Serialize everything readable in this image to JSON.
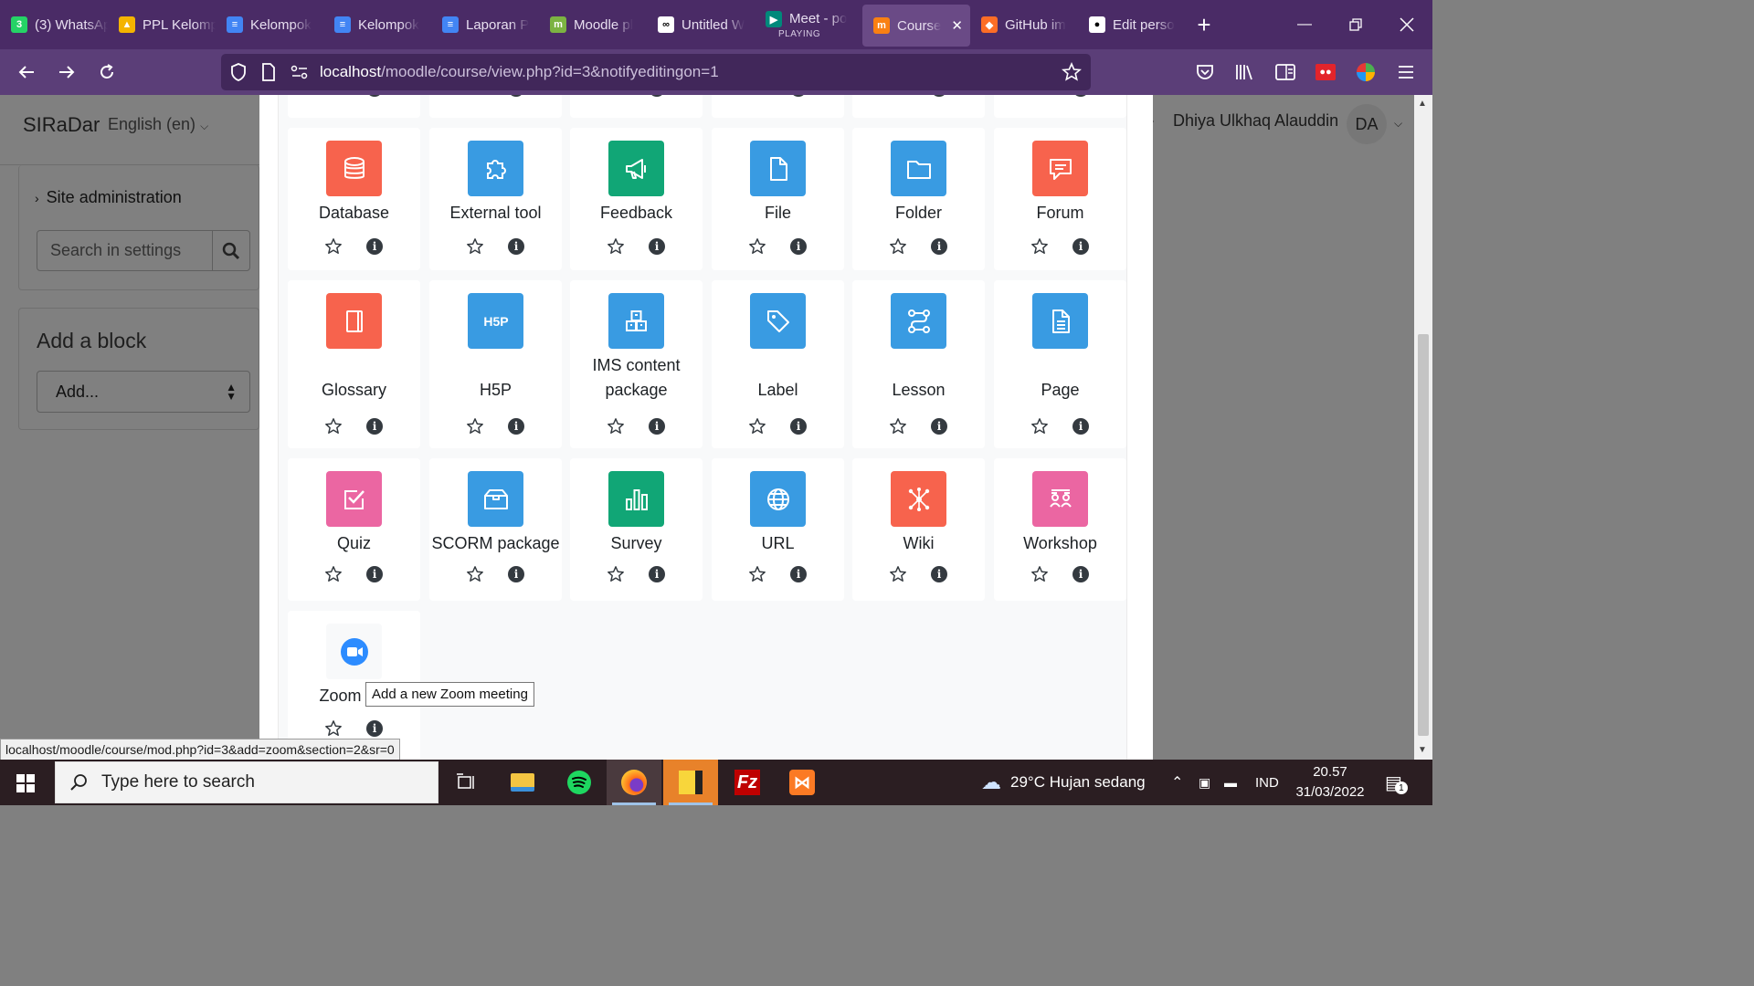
{
  "browser": {
    "tabs": [
      {
        "label": "(3) WhatsApp",
        "icon": "whatsapp-icon",
        "color": "#25d366",
        "glyph": "3"
      },
      {
        "label": "PPL Kelompok",
        "icon": "google-drive-icon",
        "color": "#f4b400",
        "glyph": "▲"
      },
      {
        "label": "Kelompok",
        "icon": "google-docs-icon",
        "color": "#4285f4",
        "glyph": "≡"
      },
      {
        "label": "Kelompok",
        "icon": "google-docs-icon",
        "color": "#4285f4",
        "glyph": "≡"
      },
      {
        "label": "Laporan P",
        "icon": "google-docs-icon",
        "color": "#4285f4",
        "glyph": "≡"
      },
      {
        "label": "Moodle pl",
        "icon": "moodle-icon",
        "color": "#7cb342",
        "glyph": "m"
      },
      {
        "label": "Untitled W",
        "icon": "drawio-icon",
        "color": "#ffffff",
        "glyph": "∞"
      },
      {
        "label": "Meet - po",
        "sub": "PLAYING",
        "icon": "google-meet-icon",
        "color": "#00897b",
        "glyph": "▶"
      },
      {
        "label": "Course",
        "icon": "moodle-icon",
        "color": "#f98012",
        "glyph": "m",
        "active": true
      },
      {
        "label": "GitHub im",
        "icon": "gitlab-icon",
        "color": "#fc6d26",
        "glyph": "◆"
      },
      {
        "label": "Edit perso",
        "icon": "github-icon",
        "color": "#ffffff",
        "glyph": "●"
      }
    ],
    "url_host": "localhost",
    "url_path": "/moodle/course/view.php?id=3&notifyeditingon=1",
    "status_url": "localhost/moodle/course/mod.php?id=3&add=zoom&section=2&sr=0"
  },
  "page": {
    "brand": "SIRaDar",
    "language": "English (en)",
    "site_admin": "Site administration",
    "search_placeholder": "Search in settings",
    "add_block_title": "Add a block",
    "add_select": "Add...",
    "user_name": "Dhiya Ulkhaq Alauddin",
    "user_initials": "DA"
  },
  "modal": {
    "activities": [
      {
        "name": "Database",
        "color": "#f7634d",
        "icon": "database-icon"
      },
      {
        "name": "External tool",
        "color": "#399be2",
        "icon": "puzzle-icon"
      },
      {
        "name": "Feedback",
        "color": "#11a676",
        "icon": "megaphone-icon"
      },
      {
        "name": "File",
        "color": "#399be2",
        "icon": "file-icon"
      },
      {
        "name": "Folder",
        "color": "#399be2",
        "icon": "folder-icon"
      },
      {
        "name": "Forum",
        "color": "#f7634d",
        "icon": "chat-icon"
      },
      {
        "name": "Glossary",
        "color": "#f7634d",
        "icon": "book-icon"
      },
      {
        "name": "H5P",
        "color": "#399be2",
        "icon": "h5p-icon"
      },
      {
        "name": "IMS content package",
        "color": "#399be2",
        "icon": "boxes-icon"
      },
      {
        "name": "Label",
        "color": "#399be2",
        "icon": "tag-icon"
      },
      {
        "name": "Lesson",
        "color": "#399be2",
        "icon": "route-icon"
      },
      {
        "name": "Page",
        "color": "#399be2",
        "icon": "page-icon"
      },
      {
        "name": "Quiz",
        "color": "#eb66a2",
        "icon": "check-square-icon"
      },
      {
        "name": "SCORM package",
        "color": "#399be2",
        "icon": "package-icon"
      },
      {
        "name": "Survey",
        "color": "#11a676",
        "icon": "bar-chart-icon"
      },
      {
        "name": "URL",
        "color": "#399be2",
        "icon": "globe-icon"
      },
      {
        "name": "Wiki",
        "color": "#f7634d",
        "icon": "network-icon"
      },
      {
        "name": "Workshop",
        "color": "#eb66a2",
        "icon": "people-icon"
      },
      {
        "name": "Zoom meeting",
        "color": "#f8f9fa",
        "icon": "zoom-icon",
        "visible_text": "Zoom me"
      }
    ],
    "tooltip": "Add a new Zoom meeting"
  },
  "taskbar": {
    "search_placeholder": "Type here to search",
    "weather": "29°C  Hujan sedang",
    "language": "IND",
    "time": "20.57",
    "date": "31/03/2022",
    "notifications": "1"
  }
}
